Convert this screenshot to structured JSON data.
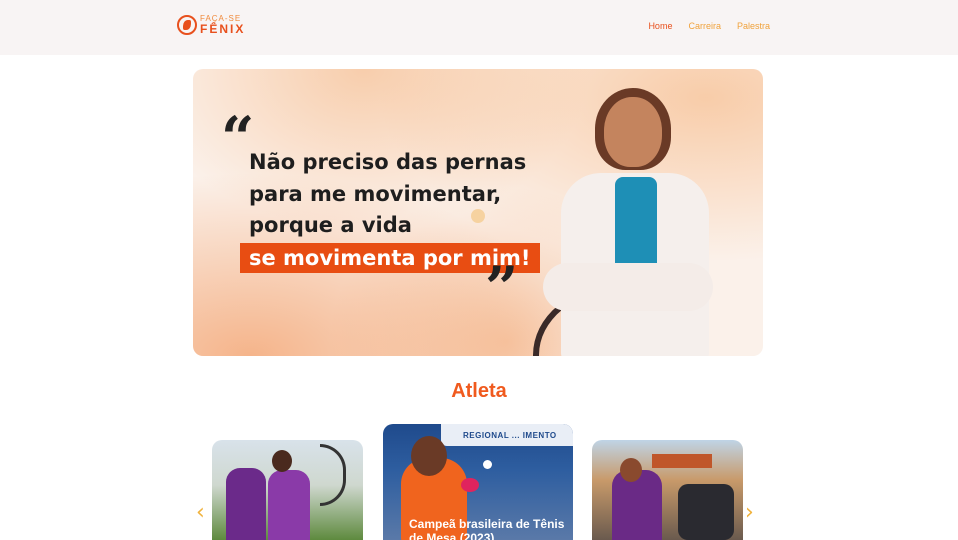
{
  "brand": {
    "line1": "FAÇA-SE",
    "line2": "FÊNIX",
    "accent": "#e8501d",
    "secondary": "#f0a23c"
  },
  "nav": {
    "items": [
      {
        "label": "Home",
        "active": true
      },
      {
        "label": "Carreira",
        "active": false
      },
      {
        "label": "Palestra",
        "active": false
      }
    ]
  },
  "hero": {
    "quote_open": "“",
    "quote_close": "”",
    "lines": [
      "Não preciso das pernas",
      "para me movimentar,",
      "porque a vida"
    ],
    "highlight": "se movimenta por mim!"
  },
  "athlete_section": {
    "title": "Atleta",
    "prev_icon": "chevron-left-icon",
    "next_icon": "chevron-right-icon",
    "prev_glyph": "‹",
    "next_glyph": "›",
    "cards": [
      {
        "caption": ""
      },
      {
        "banner": "REGIONAL ... IMENTO",
        "caption": "Campeã brasileira de Tênis de Mesa (2023)"
      },
      {
        "caption": ""
      }
    ]
  }
}
